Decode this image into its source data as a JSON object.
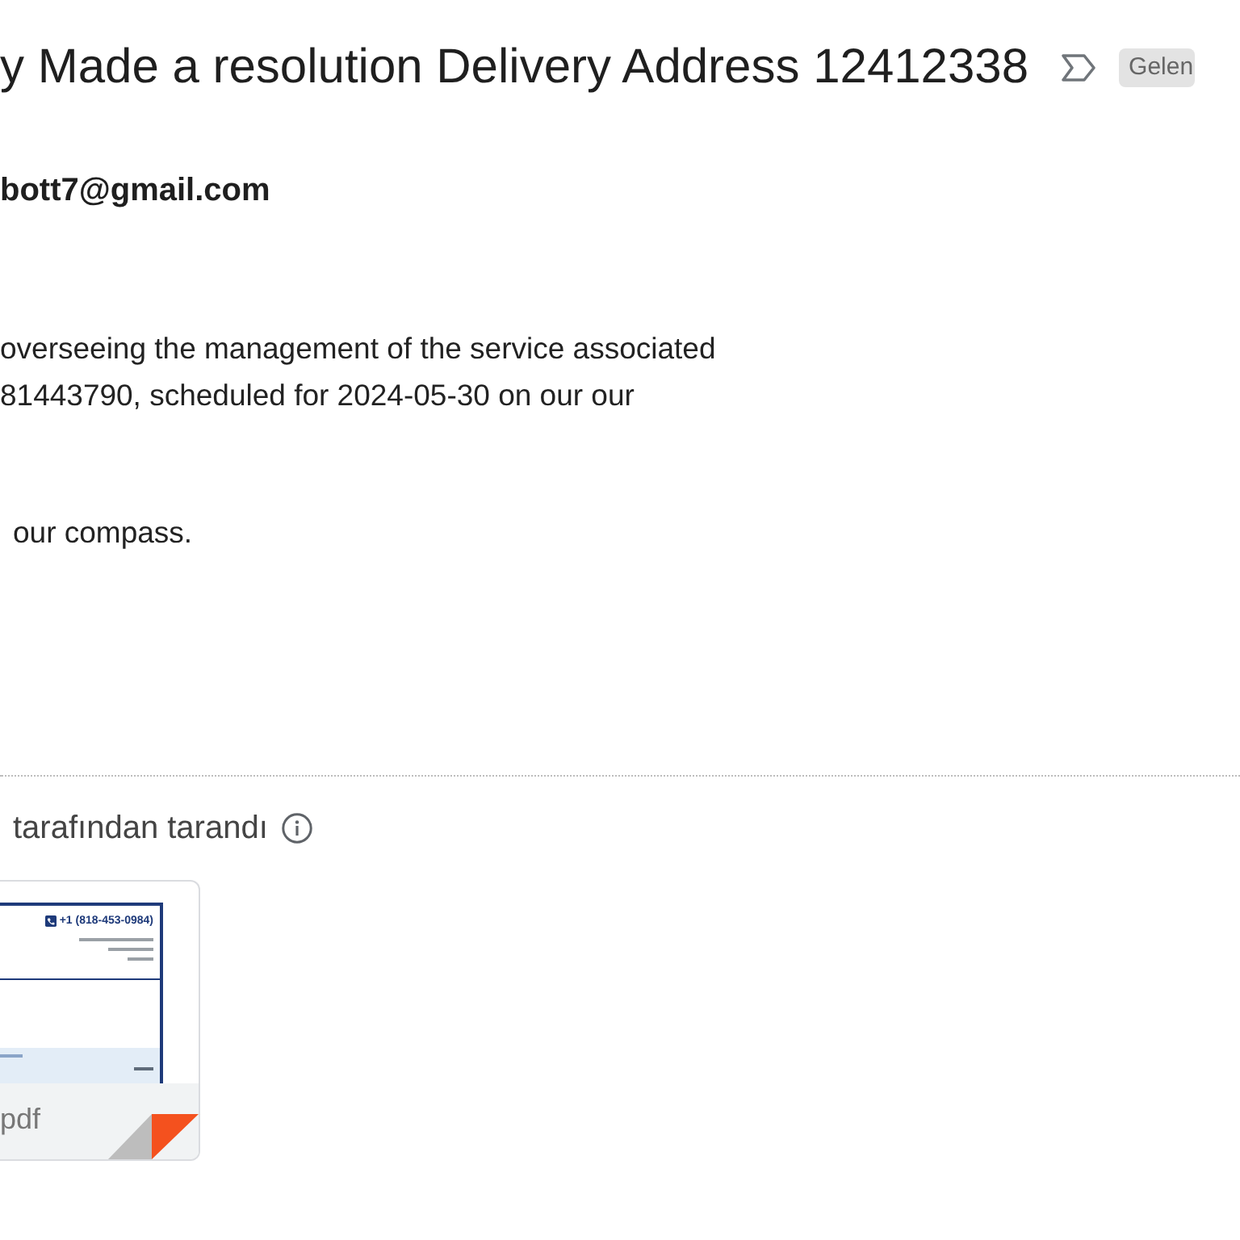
{
  "header": {
    "subject": "y Made a resolution Delivery Address 12412338",
    "important": false,
    "label": "Gelen"
  },
  "sender": {
    "email": "bott7@gmail.com"
  },
  "body": {
    "paragraphs": [
      [
        "overseeing the management of the service associated",
        "81443790, scheduled for 2024-05-30 on our our"
      ],
      [
        "our compass."
      ]
    ]
  },
  "scan_note": {
    "text": "tarafından tarandı"
  },
  "attachments": [
    {
      "preview_phone": "+1 (818-453-0984)",
      "filename": "pdf"
    }
  ]
}
